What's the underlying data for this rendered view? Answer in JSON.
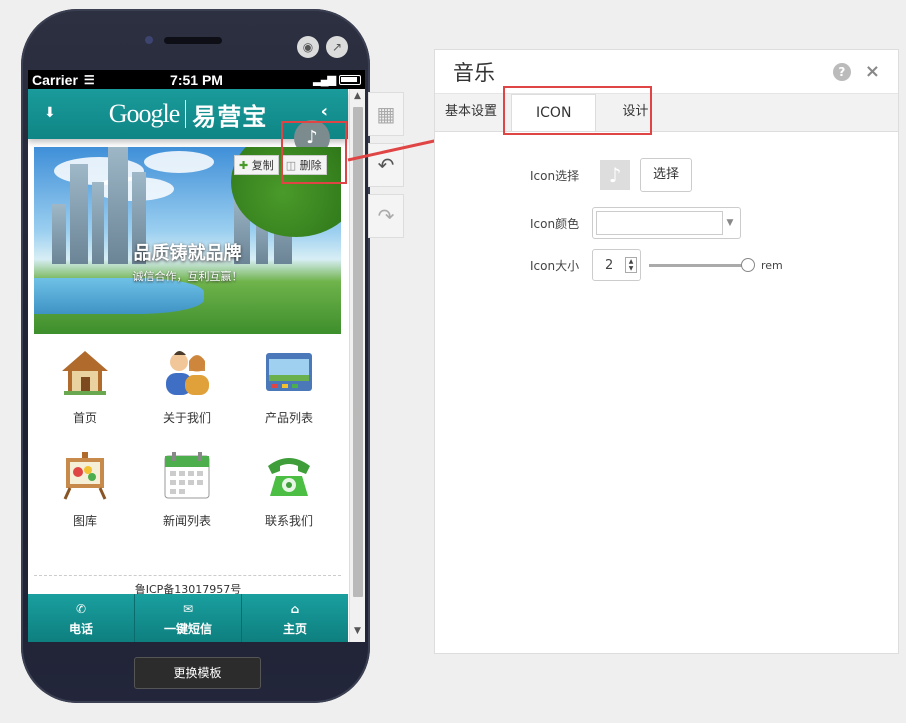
{
  "phone": {
    "statusbar": {
      "carrier": "Carrier",
      "time": "7:51 PM"
    },
    "header": {
      "brand_en": "Google",
      "brand_cn": "易营宝"
    },
    "banner": {
      "slogan": "品质铸就品牌",
      "subtitle": "诚信合作，互利互赢！"
    },
    "edit_buttons": {
      "copy": "复制",
      "delete": "删除"
    },
    "grid": [
      {
        "label": "首页",
        "icon": "house-icon"
      },
      {
        "label": "关于我们",
        "icon": "people-icon"
      },
      {
        "label": "产品列表",
        "icon": "window-icon"
      },
      {
        "label": "图库",
        "icon": "easel-icon"
      },
      {
        "label": "新闻列表",
        "icon": "calendar-icon"
      },
      {
        "label": "联系我们",
        "icon": "telephone-icon"
      }
    ],
    "icp": "鲁ICP备13017957号",
    "bottom_nav": [
      {
        "label": "电话",
        "icon": "phone-icon"
      },
      {
        "label": "一键短信",
        "icon": "message-icon"
      },
      {
        "label": "主页",
        "icon": "home-icon"
      }
    ],
    "change_template": "更换模板"
  },
  "panel": {
    "title": "音乐",
    "tabs": [
      "基本设置",
      "ICON",
      "设计"
    ],
    "icon_select": {
      "label": "Icon选择",
      "button": "选择"
    },
    "icon_color": {
      "label": "Icon颜色"
    },
    "icon_size": {
      "label": "Icon大小",
      "value": "2",
      "unit": "rem"
    }
  },
  "colors": {
    "teal": "#129090",
    "highlight": "#e04545"
  }
}
